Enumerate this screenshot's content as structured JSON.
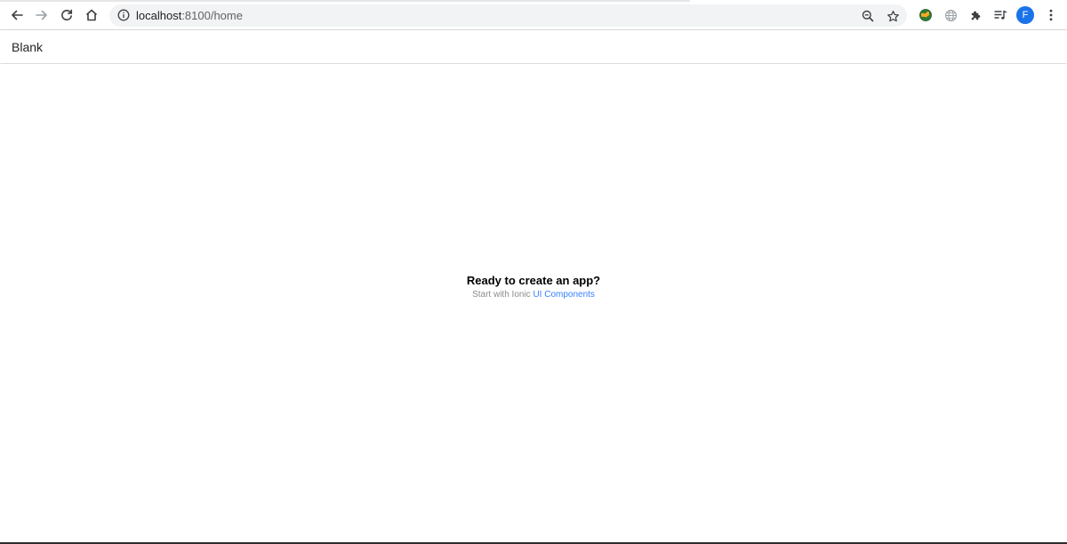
{
  "browser": {
    "url_host": "localhost",
    "url_path": ":8100/home",
    "avatar_letter": "F",
    "icons": {
      "back": "arrow-left-icon",
      "forward": "arrow-right-icon",
      "reload": "reload-icon",
      "home": "home-icon",
      "site_info": "info-icon",
      "zoom": "zoom-icon",
      "bookmark": "star-icon",
      "extension_1": "globe-colored-icon",
      "extension_2": "globe-icon",
      "extensions": "puzzle-icon",
      "media": "playlist-icon",
      "menu": "kebab-menu-icon"
    },
    "colors": {
      "omnibox_bg": "#f1f3f4",
      "avatar_bg": "#1a73e8"
    }
  },
  "app": {
    "title": "Blank"
  },
  "content": {
    "headline": "Ready to create an app?",
    "subline_prefix": "Start with Ionic ",
    "subline_link": "UI Components",
    "colors": {
      "link": "#3880ff",
      "subline": "#8c8c8c"
    }
  }
}
